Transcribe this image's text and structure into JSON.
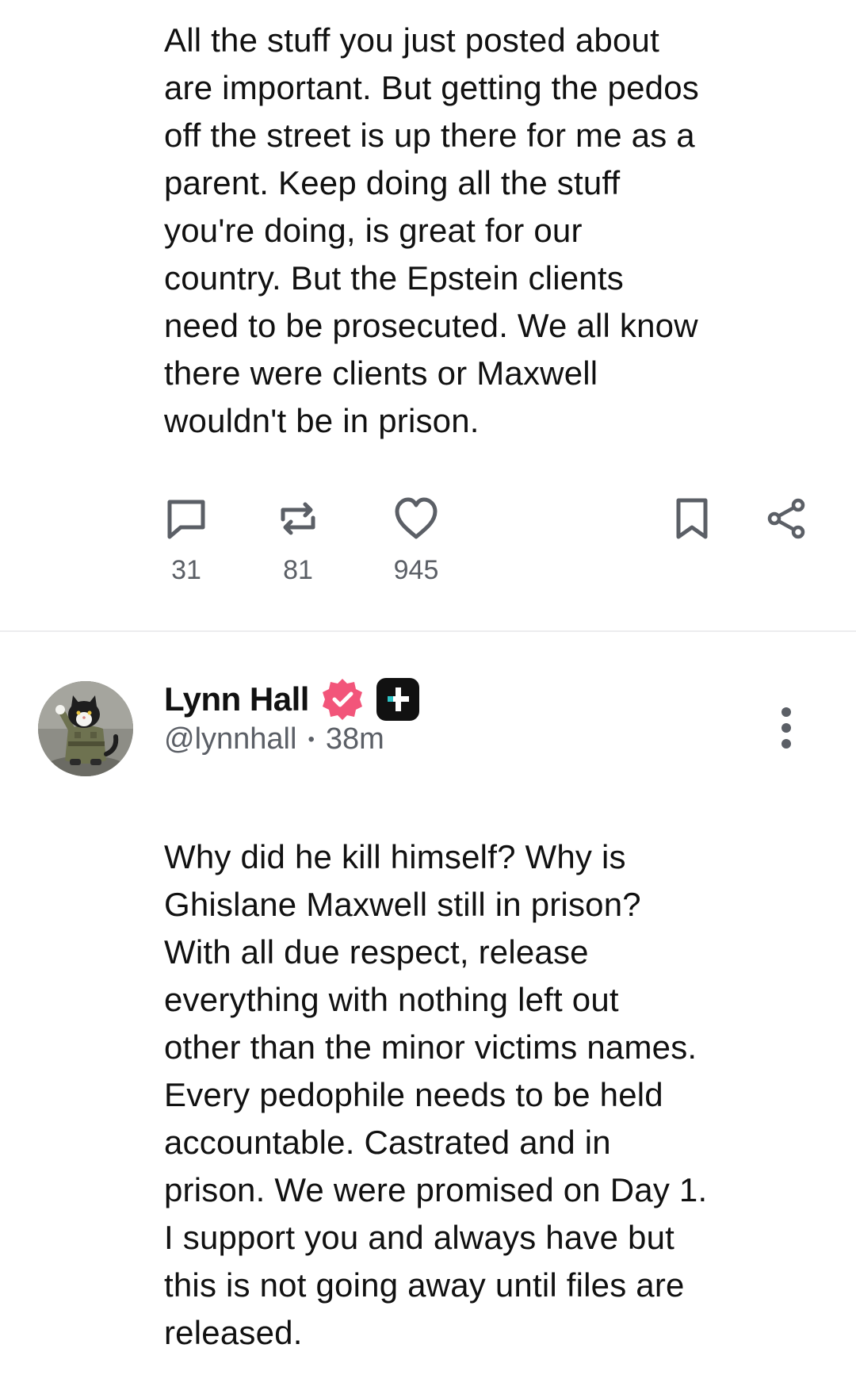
{
  "post1": {
    "body": "All the stuff you just posted about\nare important. But getting the pedos\noff the street is up there for me as a\nparent. Keep doing all the stuff\nyou're doing, is great for our\ncountry. But the Epstein clients\nneed to be prosecuted. We all know\nthere were clients or Maxwell\nwouldn't be in prison.",
    "actions": {
      "reply": {
        "icon": "comment-icon",
        "count": "31"
      },
      "repost": {
        "icon": "repost-icon",
        "count": "81"
      },
      "like": {
        "icon": "heart-icon",
        "count": "945"
      },
      "bookmark": {
        "icon": "bookmark-icon"
      },
      "share": {
        "icon": "share-icon"
      }
    }
  },
  "post2": {
    "author": {
      "name": "Lynn Hall",
      "handle": "@lynnhall",
      "separator": "•",
      "time": "38m",
      "verified_badge": "verified-icon",
      "plus_badge": "plus-badge-icon",
      "avatar": "cat-soldier-avatar"
    },
    "more_icon": "more-vertical-icon",
    "body": "Why did he kill himself? Why is\nGhislane Maxwell still in prison?\nWith all due respect, release\neverything with nothing left out\nother than the minor victims names.\nEvery pedophile needs to be held\naccountable. Castrated and in\nprison. We were promised on Day 1.\nI support you and always have but\nthis is not going away until files are\nreleased."
  },
  "colors": {
    "text": "#111111",
    "muted": "#5b5f66",
    "verified": "#f2557a",
    "plus_badge_bg": "#111111",
    "plus_badge_accent": "#2ec4c6",
    "divider": "#ececee"
  }
}
